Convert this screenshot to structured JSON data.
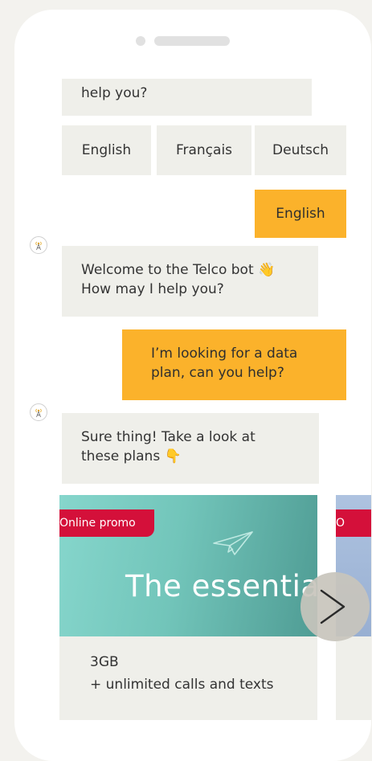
{
  "chat": {
    "previous_bot_tail": "help you?",
    "quick_replies": [
      "English",
      "Français",
      "Deutsch"
    ],
    "user_language_reply": "English",
    "bot_welcome": {
      "line1": "Welcome to the Telco bot 👋",
      "line2": "How may I help you?"
    },
    "user_question": {
      "line1": "I’m looking for a data",
      "line2": "plan, can you help?"
    },
    "bot_plans_intro": {
      "line1": "Sure thing! Take a look at",
      "line2": "these plans 👇"
    }
  },
  "carousel": {
    "cards": [
      {
        "promo_tag": "Online promo",
        "hero_text": "The essentia",
        "title": "3GB",
        "subtitle": "+ unlimited calls and texts"
      },
      {
        "promo_tag": "O"
      }
    ],
    "next_symbol": ">"
  },
  "colors": {
    "accent": "#fbb22b",
    "bot_bubble": "#efefea",
    "promo": "#d4103a"
  }
}
